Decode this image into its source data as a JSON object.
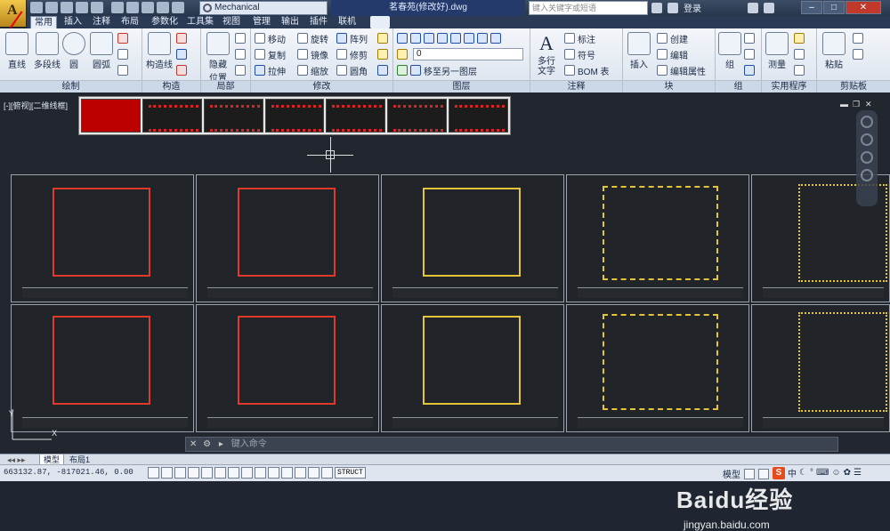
{
  "app": {
    "logo_letter": "A",
    "workspace": "Mechanical",
    "file_title": "茗春苑(修改好).dwg",
    "search_placeholder": "键入关键字或短语",
    "login": "登录"
  },
  "tabs": [
    "常用",
    "插入",
    "注释",
    "布局",
    "参数化",
    "工具集",
    "视图",
    "管理",
    "输出",
    "插件",
    "联机"
  ],
  "ribbon": {
    "draw": {
      "label": "绘制",
      "line": "直线",
      "polyline": "多段线",
      "circle": "圆",
      "arc": "圆弧"
    },
    "construct": {
      "label": "构造",
      "xline": "构造线"
    },
    "detail": {
      "label": "局部",
      "hide": "隐藏",
      "position": "位置"
    },
    "modify": {
      "label": "修改",
      "move": "移动",
      "rotate": "旋转",
      "array": "阵列",
      "copy": "复制",
      "mirror": "镜像",
      "trim": "修剪",
      "stretch": "拉伸",
      "scale": "缩放",
      "fillet": "圆角"
    },
    "layers": {
      "label": "图层",
      "layer_value": "0",
      "move_to_layer": "移至另一图层"
    },
    "annotation": {
      "label": "注释",
      "mtext": "多行文字",
      "dimension": "标注",
      "symbol": "符号",
      "bom": "BOM 表"
    },
    "block": {
      "label": "块",
      "insert": "插入",
      "create": "创建",
      "edit": "编辑",
      "edit_attr": "编辑属性"
    },
    "group": {
      "label": "组",
      "group": "组"
    },
    "utilities": {
      "label": "实用程序",
      "measure": "测量"
    },
    "clipboard": {
      "label": "剪贴板",
      "paste": "粘贴"
    }
  },
  "viewport": {
    "label": "[-][俯视][二维线框]"
  },
  "command": {
    "placeholder": "键入命令"
  },
  "layout_tabs": [
    "模型",
    "布局1"
  ],
  "status": {
    "coords": "663132.87, -817021.46, 0.00",
    "struct": "STRUCT",
    "model": "模型"
  },
  "ime": {
    "s": "S",
    "lang": "中"
  },
  "watermark": {
    "brand": "Baidu经验",
    "url": "jingyan.baidu.com"
  }
}
